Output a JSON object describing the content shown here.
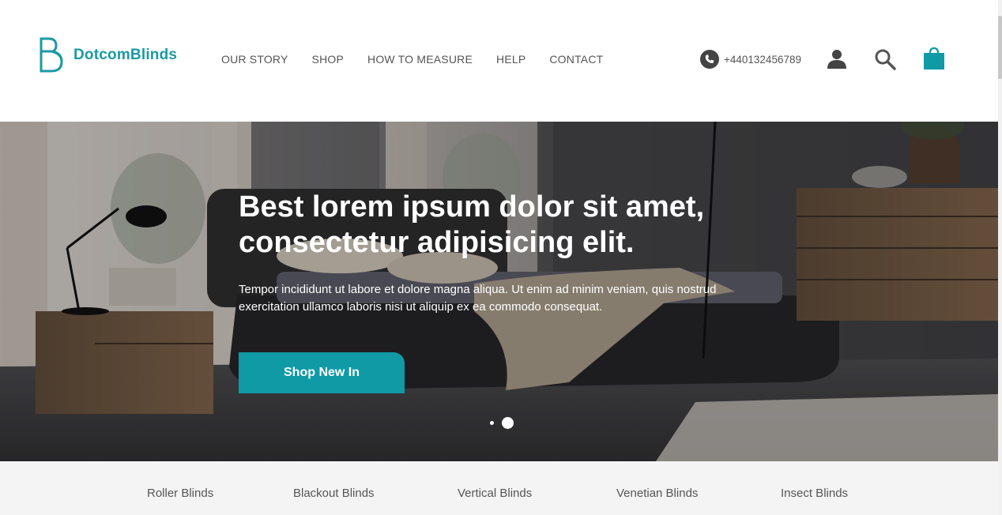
{
  "brand": {
    "name": "DotcomBlinds",
    "accent_color": "#1a9aa3",
    "logo_icon": "b-letter-logo-icon"
  },
  "nav": {
    "items": [
      {
        "label": "OUR STORY"
      },
      {
        "label": "SHOP"
      },
      {
        "label": "HOW TO MEASURE"
      },
      {
        "label": "HELP"
      },
      {
        "label": "CONTACT"
      }
    ]
  },
  "header_actions": {
    "phone": "+440132456789",
    "phone_icon": "phone-icon",
    "account_icon": "user-icon",
    "search_icon": "search-icon",
    "cart_icon": "shopping-bag-icon",
    "cart_color": "#0f9aa6"
  },
  "hero": {
    "title_line1": "Best lorem ipsum dolor sit amet,",
    "title_line2": "consectetur adipisicing elit.",
    "subtitle_line1": "Tempor incididunt ut labore et dolore magna aliqua. Ut enim ad minim veniam, quis nostrud",
    "subtitle_line2": "exercitation ullamco laboris nisi ut aliquip ex ea commodo consequat.",
    "cta_label": "Shop New In",
    "cta_color": "#0f9aa6",
    "slide_count": 2,
    "active_slide": 2
  },
  "categories": [
    {
      "label": "Roller Blinds"
    },
    {
      "label": "Blackout Blinds"
    },
    {
      "label": "Vertical Blinds"
    },
    {
      "label": "Venetian Blinds"
    },
    {
      "label": "Insect Blinds"
    }
  ]
}
